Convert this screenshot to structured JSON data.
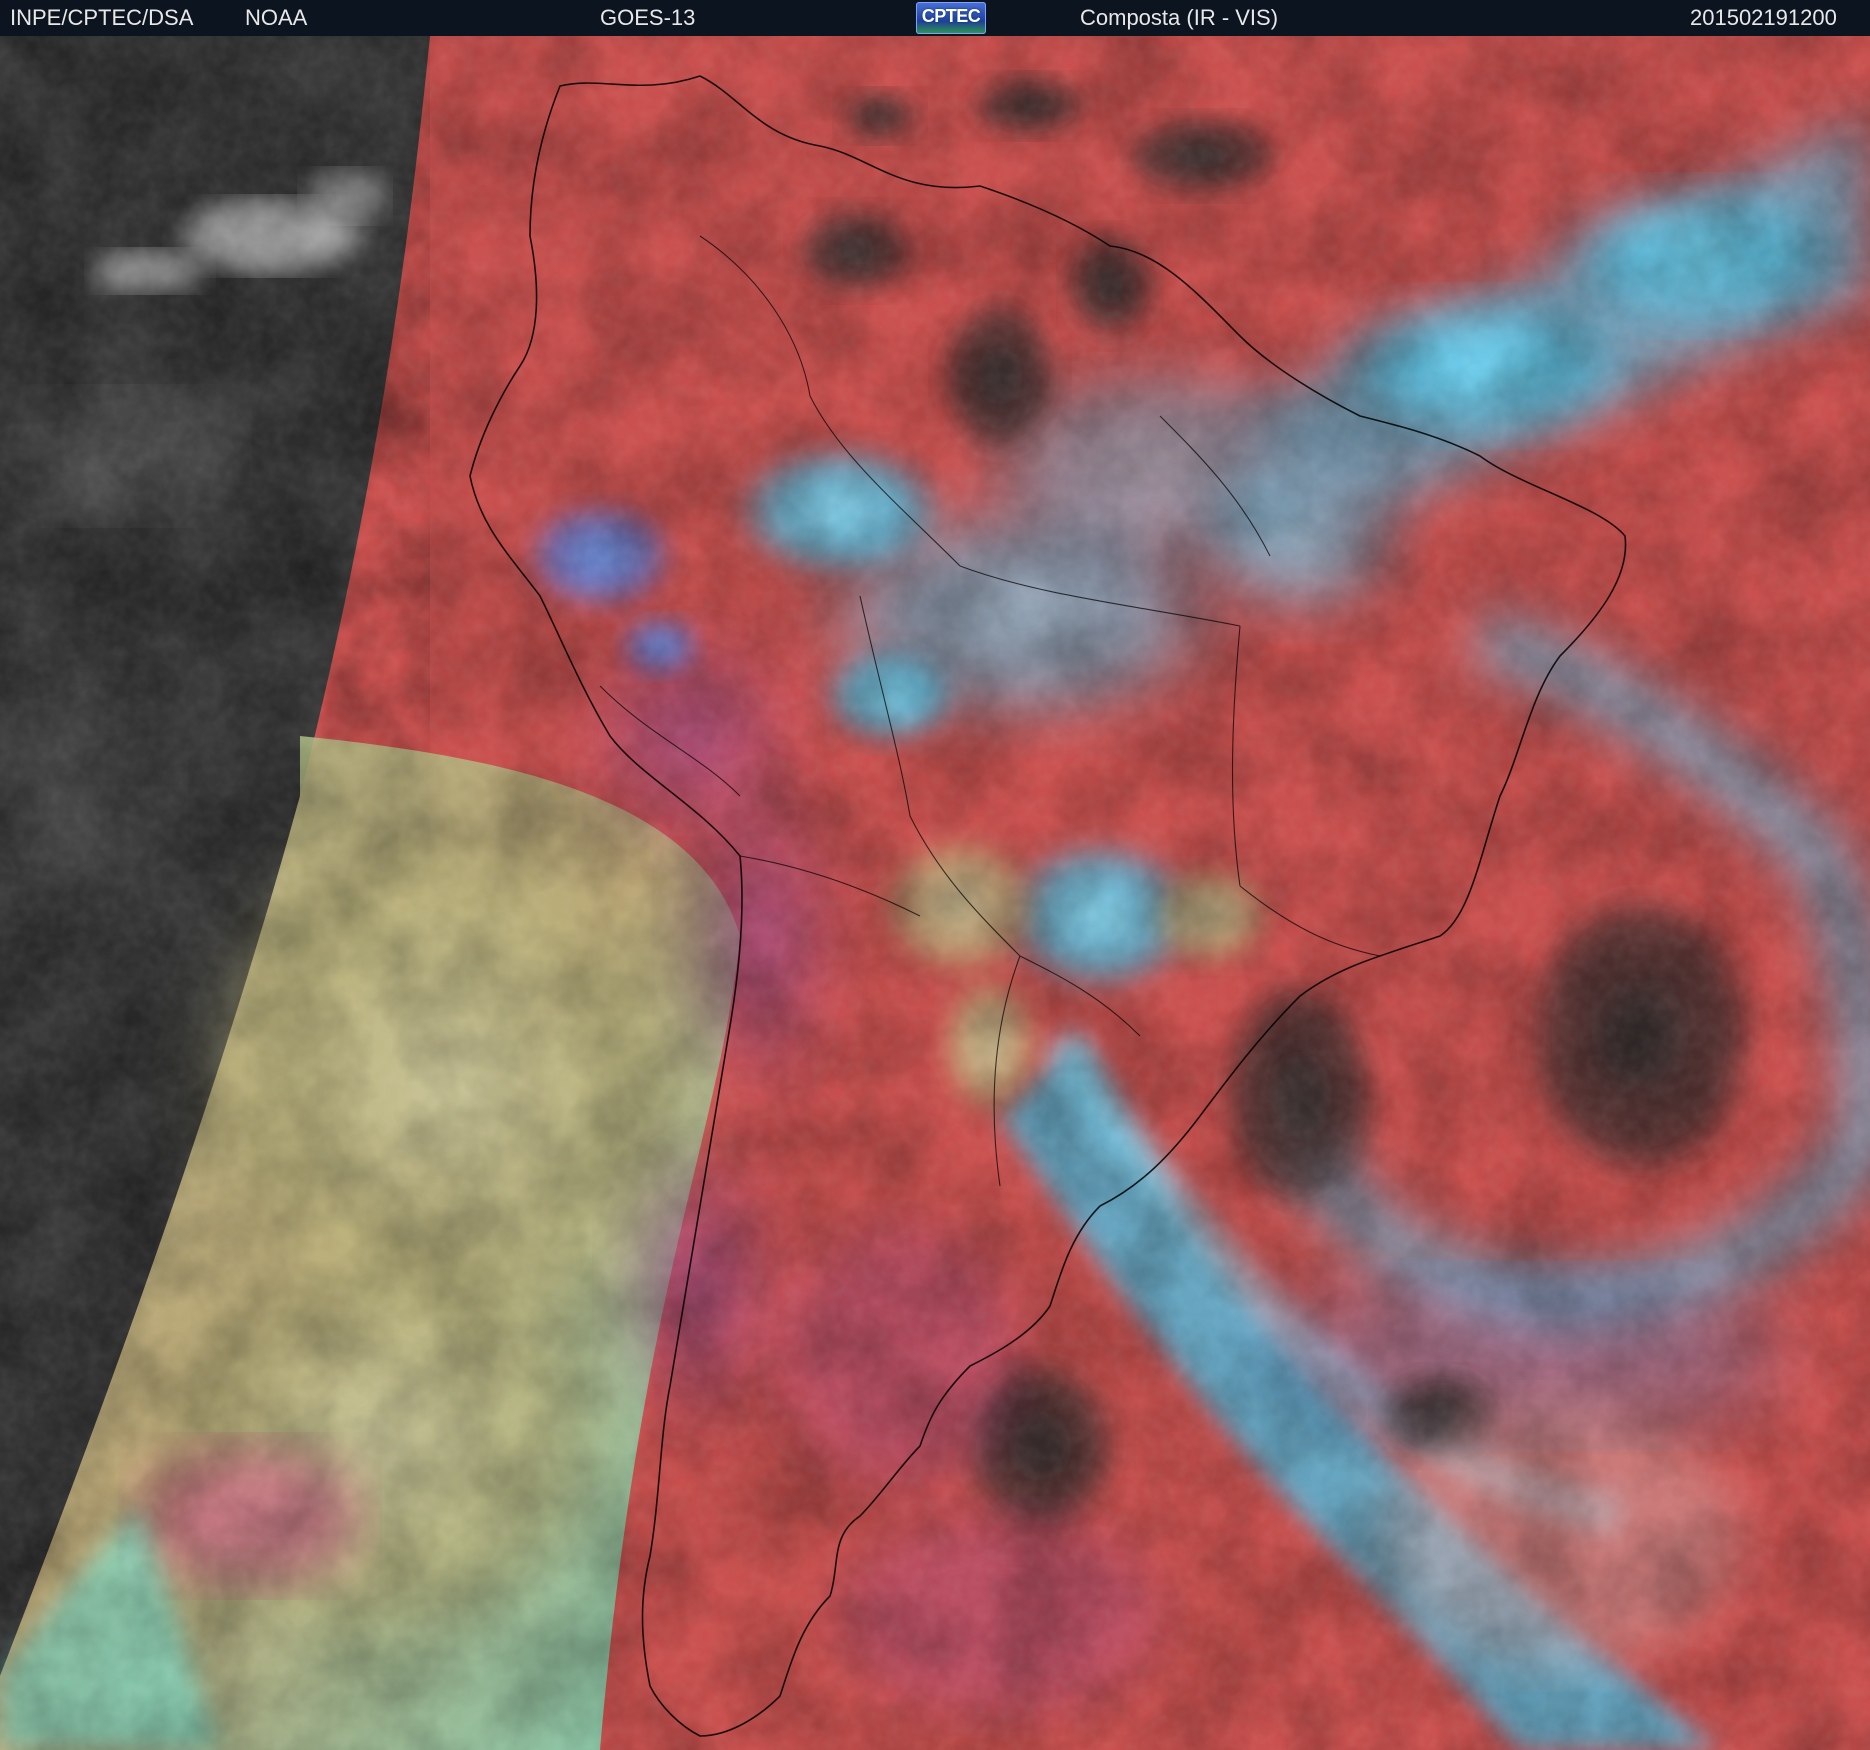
{
  "header": {
    "source": "INPE/CPTEC/DSA",
    "agency": "NOAA",
    "satellite": "GOES-13",
    "logo": "CPTEC",
    "product": "Composta (IR - VIS)",
    "timestamp": "201502191200"
  },
  "colors": {
    "header_bg": "#0c1420",
    "header_text": "#e8e8e8",
    "land_clear": "#c9504e",
    "low_cloud": "#b8b27a",
    "high_cloud": "#3bc8f0",
    "deep_convection": "#5fd6ff",
    "space_outside_visible": "#3a3a3a",
    "coastline": "#000000"
  },
  "icons": {
    "logo": "cptec-logo"
  }
}
